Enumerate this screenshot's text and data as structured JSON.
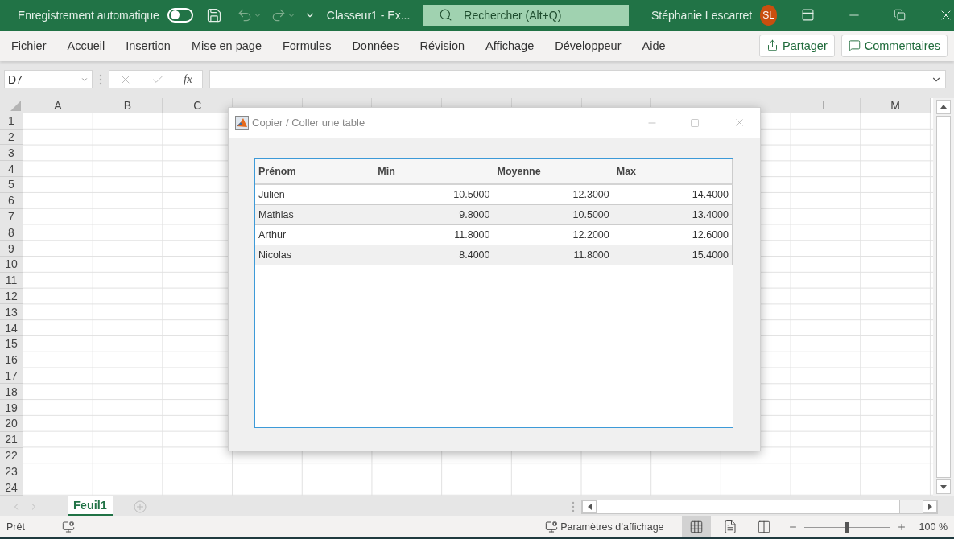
{
  "title_bar": {
    "autosave_label": "Enregistrement automatique",
    "autosave_on": false,
    "document_title": "Classeur1  -  Ex...",
    "search_placeholder": "Rechercher (Alt+Q)",
    "user_name": "Stéphanie Lescarret",
    "avatar_initials": "SL"
  },
  "ribbon": {
    "tabs": [
      "Fichier",
      "Accueil",
      "Insertion",
      "Mise en page",
      "Formules",
      "Données",
      "Révision",
      "Affichage",
      "Développeur",
      "Aide"
    ],
    "share_button": "Partager",
    "comments_button": "Commentaires"
  },
  "formula_bar": {
    "name_box": "D7",
    "function_label": "fx"
  },
  "sheet": {
    "columns_left": [
      "A",
      "B",
      "C"
    ],
    "columns_right": [
      "L",
      "M"
    ],
    "rows": [
      "1",
      "2",
      "3",
      "4",
      "5",
      "6",
      "7",
      "8",
      "9",
      "10",
      "11",
      "12",
      "13",
      "14",
      "15",
      "16",
      "17",
      "18",
      "19",
      "20",
      "21",
      "22",
      "23",
      "24"
    ]
  },
  "dialog": {
    "title": "Copier / Coller une table",
    "table": {
      "columns": [
        "Prénom",
        "Min",
        "Moyenne",
        "Max"
      ],
      "rows": [
        [
          "Julien",
          "10.5000",
          "12.3000",
          "14.4000"
        ],
        [
          "Mathias",
          "9.8000",
          "10.5000",
          "13.4000"
        ],
        [
          "Arthur",
          "11.8000",
          "12.2000",
          "12.6000"
        ],
        [
          "Nicolas",
          "8.4000",
          "11.8000",
          "15.4000"
        ]
      ]
    }
  },
  "sheet_tabs": [
    {
      "label": "Feuil1",
      "selected": true
    }
  ],
  "status_bar": {
    "status": "Prêt",
    "display_settings": "Paramètres d’affichage",
    "views": [
      {
        "kind": "normal",
        "selected": true
      },
      {
        "kind": "page_layout",
        "selected": false
      },
      {
        "kind": "page_break",
        "selected": false
      }
    ],
    "zoom_slider": {
      "level": 0.5
    },
    "zoom": "100 %"
  }
}
